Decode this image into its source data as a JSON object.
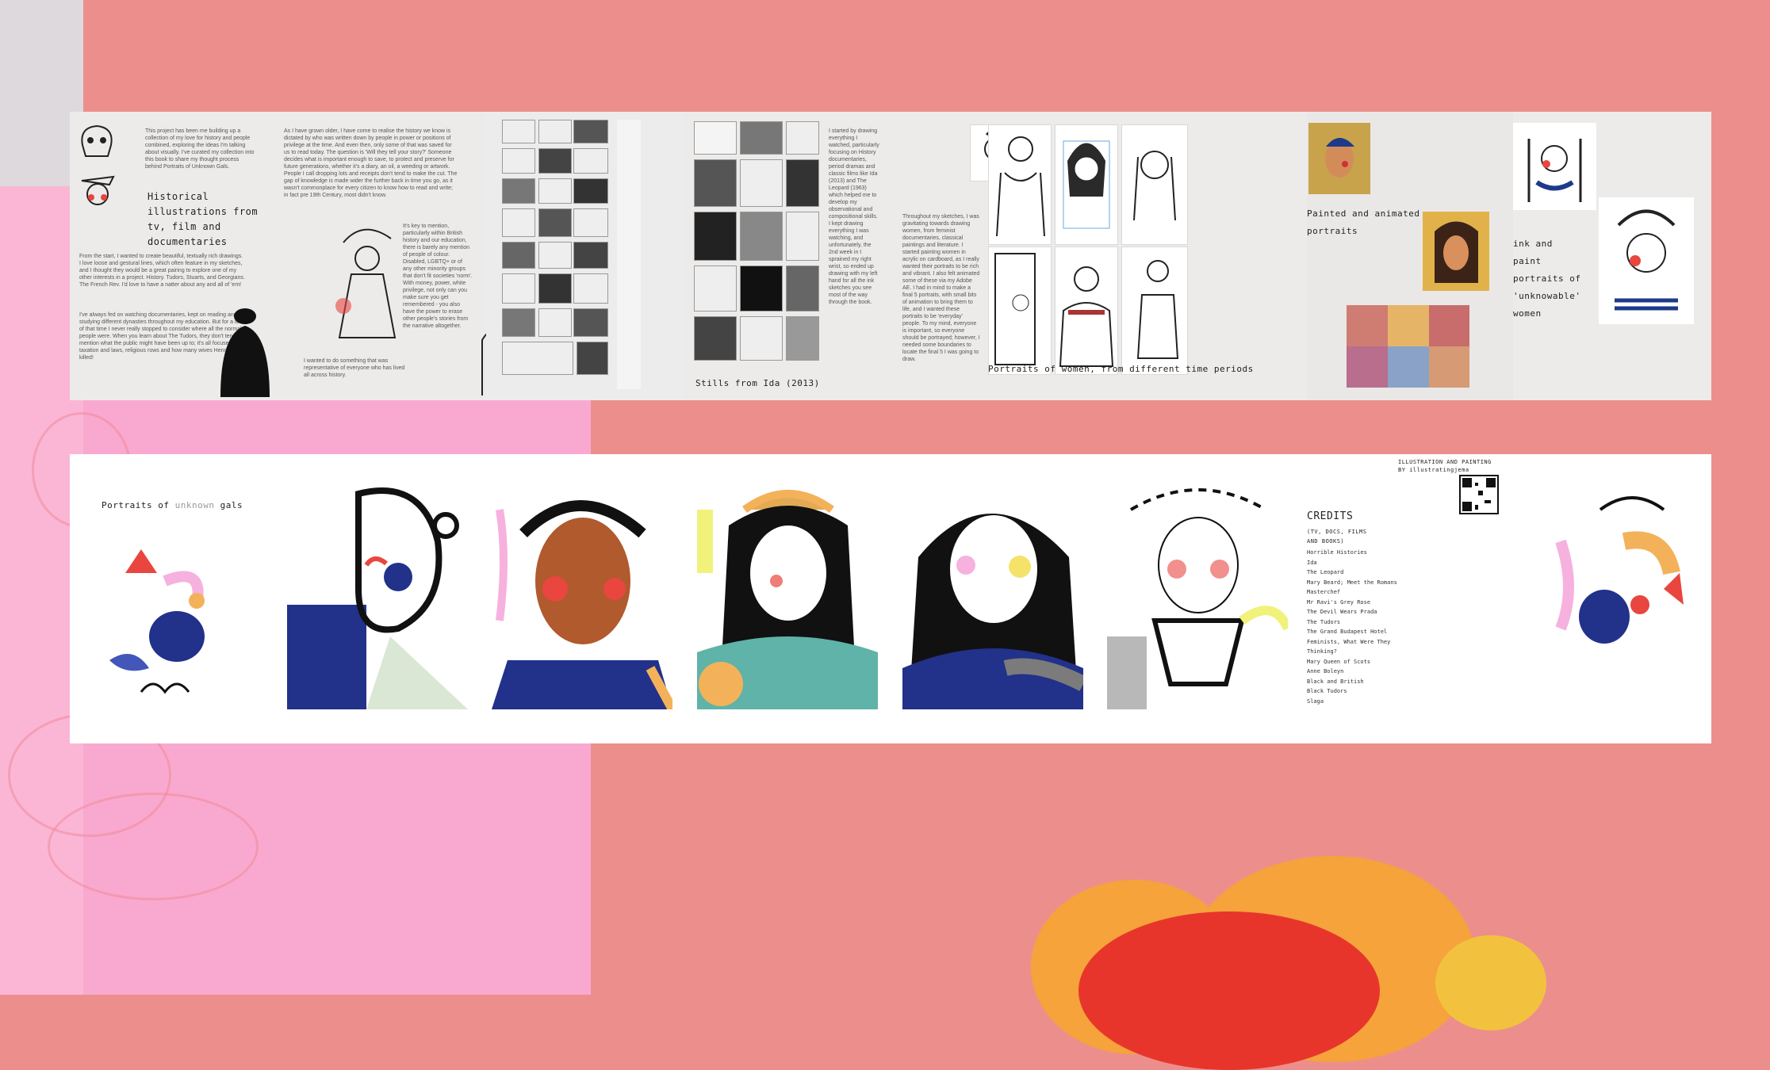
{
  "top_strip": {
    "intro_paragraph_1": "This project has been me building up a collection of my love for history and people combined, exploring the ideas I'm talking about visually. I've curated my collection into this book to share my thought process behind Portraits of Unknown Gals.",
    "intro_heading": "Historical illustrations from tv, film and documentaries",
    "intro_paragraph_2": "From the start, I wanted to create beautiful, textually rich drawings. I love loose and gestural lines, which often feature in my sketches, and I thought they would be a great pairing to explore one of my other interests in a project. History. Tudors, Stuarts, and Georgians. The French Rev. I'd love to have a natter about any and all of 'em!",
    "intro_paragraph_3": "I've always fed on watching documentaries, kept on reading and studying different dynasties throughout my education. But for a lot of that time I never really stopped to consider where all the normal people were. When you learn about The Tudors, they don't tend to mention what the public might have been up to; it's all focused on taxation and laws, religious rows and how many wives Henry VIII killed!",
    "col2_paragraph_1": "As I have grown older, I have come to realise the history we know is dictated by who was written down by people in power or positions of privilege at the time. And even then, only some of that was saved for us to read today. The question is 'Will they tell your story?' Someone decides what is important enough to save, to protect and preserve for future generations, whether it's a diary, an oil, a weeding or artwork. People I call dropping lots and receipts don't tend to make the cut. The gap of knowledge is made wider the further back in time you go, as it wasn't commonplace for every citizen to know how to read and write; in fact pre 19th Century, most didn't know.",
    "col2_paragraph_2": "It's key to mention, particularly within British history and our education, there is barely any mention of people of colour. Disabled, LGBTQ+ or of any other minority groups that don't fit societies 'norm'. With money, power, white privilege, not only can you make sure you get remembered - you also have the power to erase other people's stories from the narrative altogether.",
    "col2_paragraph_3": "I wanted to do something that was representative of everyone who has lived all across history.",
    "col4_paragraph": "I started by drawing everything I watched, particularly focusing on History documentaries, period dramas and classic films like Ida (2013) and The Leopard (1963) which helped me to develop my observational and compositional skills. I kept drawing everything I was watching, and unfortunately, the 2nd week in I sprained my right wrist, so ended up drawing with my left hand for all the ink sketches you see most of the way through the book.",
    "col5_paragraph": "Throughout my sketches, I was gravitating towards drawing women, from feminist documentaries, classical paintings and literature. I started painting women in acrylic on cardboard, as I really wanted their portraits to be rich and vibrant. I also felt animated some of these via my Adobe AE. I had in mind to make a final 5 portraits, with small bits of animation to bring them to life, and I wanted these portraits to be 'everyday' people. To my mind, everyone is important, so everyone should be portrayed; however, I needed some boundaries to locate the final 5 I was going to draw.",
    "caption_stills": "Stills from Ida (2013)",
    "caption_portraits": "Portraits of women, from different time periods",
    "heading_painted": "Painted and animated portraits",
    "heading_ink": "ink and paint portraits of 'unknowable' women"
  },
  "bottom_strip": {
    "cover_title_part1": "Portraits of ",
    "cover_title_part2": "unknown",
    "cover_title_part3": " gals",
    "illustration_label": "ILLUSTRATION AND PAINTING",
    "handle": "BY illustratingjema",
    "credits_title": "CREDITS",
    "credits_subtitle": "(TV, DOCS, FILMS AND BOOKS)",
    "credits": [
      "Horrible Histories",
      "Ida",
      "The Leopard",
      "Mary Beard; Meet the Romans",
      "Masterchef",
      "Mr Ravi's Grey Rose",
      "The Devil Wears Prada",
      "The Tudors",
      "The Grand Budapest Hotel",
      "Feminists, What Were They Thinking?",
      "Mary Queen of Scots",
      "Anne Boleyn",
      "Black and British",
      "Black Tudors",
      "Slaga"
    ]
  },
  "colors": {
    "background": "#ec8f8c",
    "pink_panel": "#f9a9cf",
    "paper": "#ecebea",
    "navy": "#22318a",
    "mustard": "#f3b25a",
    "red": "#e8463f"
  }
}
